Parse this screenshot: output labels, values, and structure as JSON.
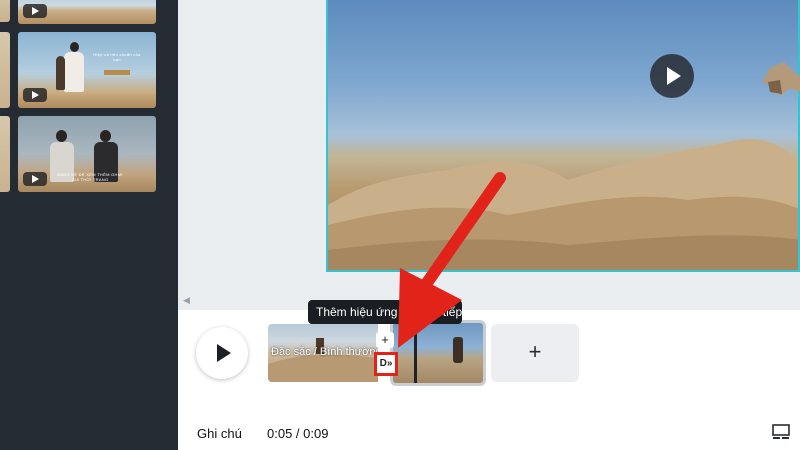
{
  "timeline": {
    "clip1_label": "Đặc sắc / Bình thường",
    "tooltip": "Thêm hiệu ứng chuyển tiếp",
    "add_label": "+",
    "transition_label": "+",
    "effect_label": "D»"
  },
  "footer": {
    "notes_label": "Ghi chú",
    "time_display": "0:05 / 0:09"
  },
  "panel": {
    "collapse_label": "‹",
    "thumb2_text": "Hiệp cả tiêu chuẩn của bạn",
    "thumb3_text": "ĐÁNG KỆ ĐỂ XEM THÊM GHMI GIA THỜI TRANG"
  },
  "colors": {
    "accent": "#35c3d0",
    "highlight": "#e2231a"
  }
}
